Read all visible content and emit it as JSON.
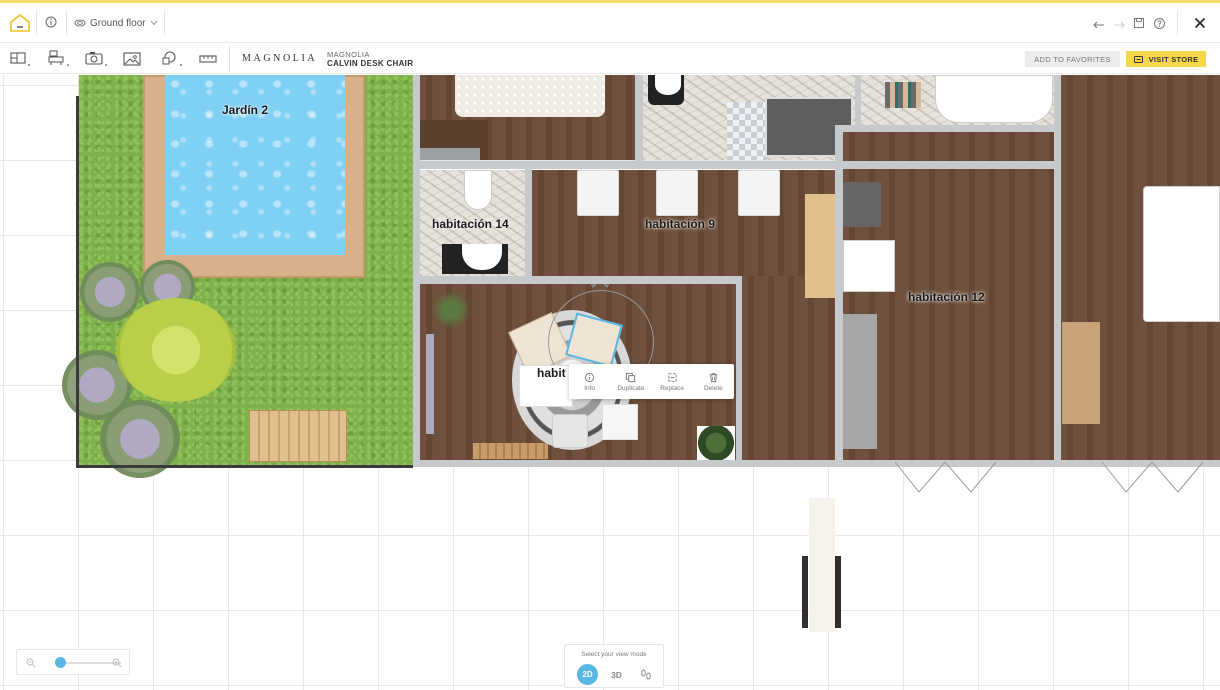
{
  "header": {
    "floor_label": "Ground floor",
    "brand_logo": "MAGNOLIA",
    "product_brand": "MAGNOLIA",
    "product_name": "CALVIN DESK CHAIR",
    "favorites_label": "ADD TO FAVORITES",
    "store_label": "VISIT STORE",
    "accent_color": "#f6d64a"
  },
  "toolbar": {
    "tools": [
      {
        "name": "floor-plan-tool",
        "icon": "layout-icon"
      },
      {
        "name": "furniture-tool",
        "icon": "catalog-icon"
      },
      {
        "name": "camera-tool",
        "icon": "camera-icon"
      },
      {
        "name": "image-tool",
        "icon": "image-icon"
      },
      {
        "name": "shapes-tool",
        "icon": "shapes-icon"
      },
      {
        "name": "measure-tool",
        "icon": "ruler-icon"
      }
    ]
  },
  "plan": {
    "rooms": [
      {
        "label": "Jardín 2"
      },
      {
        "label": "habitación 14"
      },
      {
        "label": "habitación 9"
      },
      {
        "label": "habitación 12"
      },
      {
        "label": "habit"
      }
    ]
  },
  "context_menu": {
    "items": [
      {
        "label": "Info",
        "icon": "info-icon"
      },
      {
        "label": "Duplicate",
        "icon": "duplicate-icon"
      },
      {
        "label": "Replace",
        "icon": "replace-icon"
      },
      {
        "label": "Delete",
        "icon": "trash-icon"
      }
    ]
  },
  "zoom": {
    "level": 0.15
  },
  "view_mode": {
    "title": "Select your view mode",
    "mode_2d": "2D",
    "mode_3d": "3D",
    "active": "2D",
    "active_color": "#58b7e3"
  }
}
